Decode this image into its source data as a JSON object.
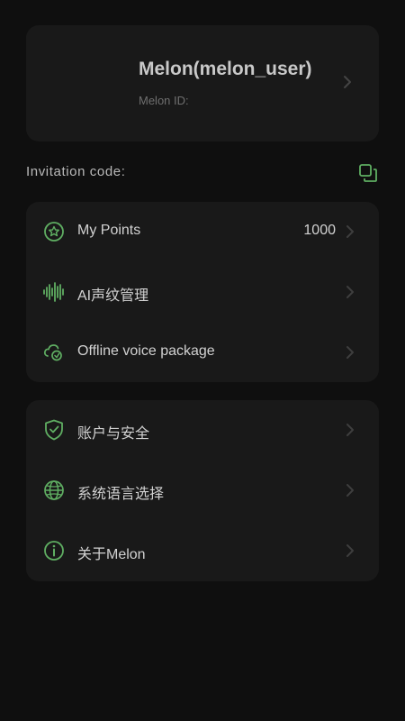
{
  "profile": {
    "name": "Melon(melon_user)",
    "id_label": "Melon ID:"
  },
  "invitation": {
    "label": "Invitation code:"
  },
  "menu_group_1": [
    {
      "label": "My Points",
      "value": "1000",
      "icon": "star-badge-icon"
    },
    {
      "label": "AI声纹管理",
      "icon": "waveform-icon"
    },
    {
      "label": "Offline voice package",
      "icon": "cloud-offline-icon"
    }
  ],
  "menu_group_2": [
    {
      "label": "账户与安全",
      "icon": "shield-check-icon"
    },
    {
      "label": "系统语言选择",
      "icon": "globe-icon"
    },
    {
      "label": "关于Melon",
      "icon": "info-icon"
    }
  ],
  "colors": {
    "background": "#0f0f0f",
    "card": "#191919",
    "accent": "#5fae62",
    "text_primary": "#d2d2d2",
    "text_muted": "#6f6f6f"
  }
}
